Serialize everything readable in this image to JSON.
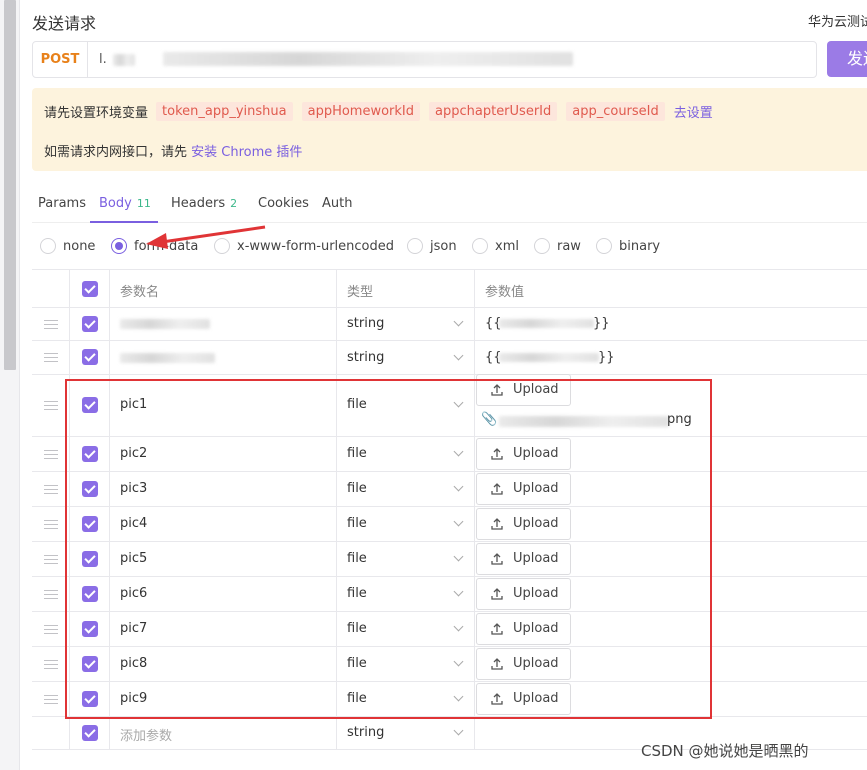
{
  "header": {
    "title": "发送请求",
    "right_text": "华为云测试"
  },
  "request": {
    "method": "POST",
    "url": "l.",
    "url_blurred": "mmmmmmm",
    "send_label": "发送"
  },
  "notice": {
    "env_label": "请先设置环境变量",
    "env_vars": [
      "token_app_yinshua",
      "appHomeworkId",
      "appchapterUserId",
      "app_courseId"
    ],
    "setup_link": "去设置",
    "line2_prefix": "如需请求内网接口，请先",
    "line2_link": "安装 Chrome 插件"
  },
  "tabs": [
    {
      "label": "Params",
      "count": ""
    },
    {
      "label": "Body",
      "count": "11"
    },
    {
      "label": "Headers",
      "count": "2"
    },
    {
      "label": "Cookies",
      "count": ""
    },
    {
      "label": "Auth",
      "count": ""
    }
  ],
  "active_tab": "Body",
  "body_types": [
    "none",
    "form-data",
    "x-www-form-urlencoded",
    "json",
    "xml",
    "raw",
    "binary"
  ],
  "selected_body_type": "form-data",
  "table": {
    "headers": {
      "name": "参数名",
      "type": "类型",
      "value": "参数值"
    },
    "upload_label": "Upload",
    "rows": [
      {
        "name": "",
        "type": "string",
        "value": "{{",
        "value_end": "}}",
        "checked": true
      },
      {
        "name": "",
        "type": "string",
        "value": "{{",
        "value_end": "}}",
        "checked": true
      },
      {
        "name": "pic1",
        "type": "file",
        "upload": true,
        "file_suffix": "png",
        "checked": true
      },
      {
        "name": "pic2",
        "type": "file",
        "upload": true,
        "checked": true
      },
      {
        "name": "pic3",
        "type": "file",
        "upload": true,
        "checked": true
      },
      {
        "name": "pic4",
        "type": "file",
        "upload": true,
        "checked": true
      },
      {
        "name": "pic5",
        "type": "file",
        "upload": true,
        "checked": true
      },
      {
        "name": "pic6",
        "type": "file",
        "upload": true,
        "checked": true
      },
      {
        "name": "pic7",
        "type": "file",
        "upload": true,
        "checked": true
      },
      {
        "name": "pic8",
        "type": "file",
        "upload": true,
        "checked": true
      },
      {
        "name": "pic9",
        "type": "file",
        "upload": true,
        "checked": true
      }
    ],
    "add_row": {
      "placeholder": "添加参数",
      "type": "string"
    }
  },
  "watermark": "CSDN @她说她是晒黑的",
  "colors": {
    "accent": "#7a5fe0",
    "method": "#e8811a",
    "annotation": "#e03436"
  }
}
